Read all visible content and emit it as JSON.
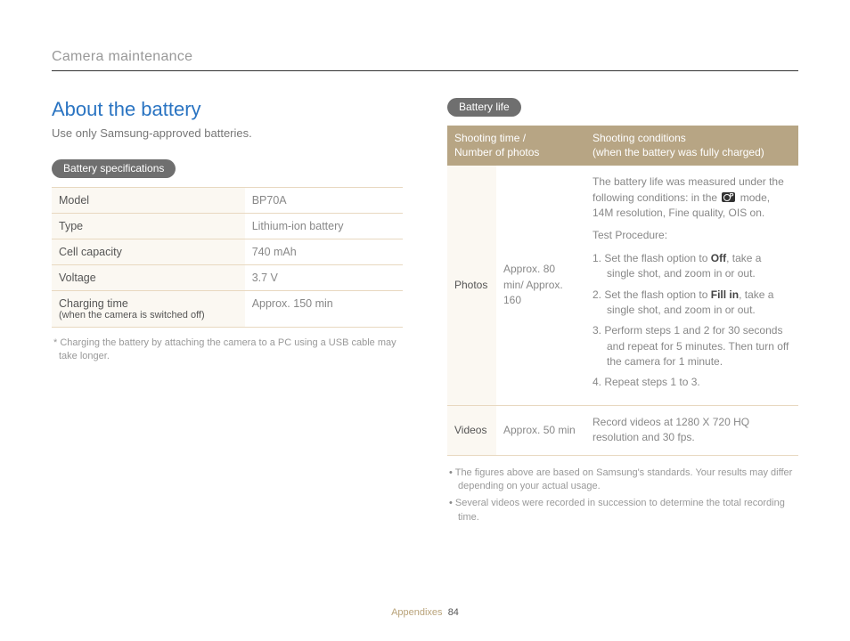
{
  "header": "Camera maintenance",
  "title": "About the battery",
  "intro": "Use only Samsung-approved batteries.",
  "pill_specs": "Battery specifications",
  "specs_rows": [
    {
      "label": "Model",
      "sub": "",
      "value": "BP70A"
    },
    {
      "label": "Type",
      "sub": "",
      "value": "Lithium-ion battery"
    },
    {
      "label": "Cell capacity",
      "sub": "",
      "value": "740 mAh"
    },
    {
      "label": "Voltage",
      "sub": "",
      "value": "3.7 V"
    },
    {
      "label": "Charging time",
      "sub": "(when the camera is switched off)",
      "value": "Approx. 150 min"
    }
  ],
  "specs_footnote": "* Charging the battery by attaching the camera to a PC using a USB cable may take longer.",
  "pill_life": "Battery life",
  "life_header": {
    "col1_l1": "Shooting time /",
    "col1_l2": "Number of photos",
    "col2_l1": "Shooting conditions",
    "col2_l2": "(when the battery was fully charged)"
  },
  "photos_row": {
    "label": "Photos",
    "mid": "Approx. 80 min/ Approx. 160",
    "intro_a": "The battery life was measured under the following conditions: in the ",
    "intro_b": " mode, 14M resolution, Fine quality, OIS on.",
    "test_label": "Test Procedure:",
    "step1_a": "1. Set the flash option to ",
    "step1_bold": "Off",
    "step1_b": ", take a single shot, and zoom in or out.",
    "step2_a": "2. Set the flash option to ",
    "step2_bold": "Fill in",
    "step2_b": ", take a single shot, and zoom in or out.",
    "step3": "3. Perform steps 1 and 2 for 30 seconds and repeat for 5 minutes. Then turn off the camera for 1 minute.",
    "step4": "4. Repeat steps 1 to 3."
  },
  "videos_row": {
    "label": "Videos",
    "mid": "Approx. 50 min",
    "cond": "Record videos at 1280 X 720 HQ resolution and 30 fps."
  },
  "life_bullets": [
    "The figures above are based on Samsung's standards. Your results may differ depending on your actual usage.",
    "Several videos were recorded in succession to determine the total recording time."
  ],
  "footer": {
    "section": "Appendixes",
    "page": "84"
  }
}
